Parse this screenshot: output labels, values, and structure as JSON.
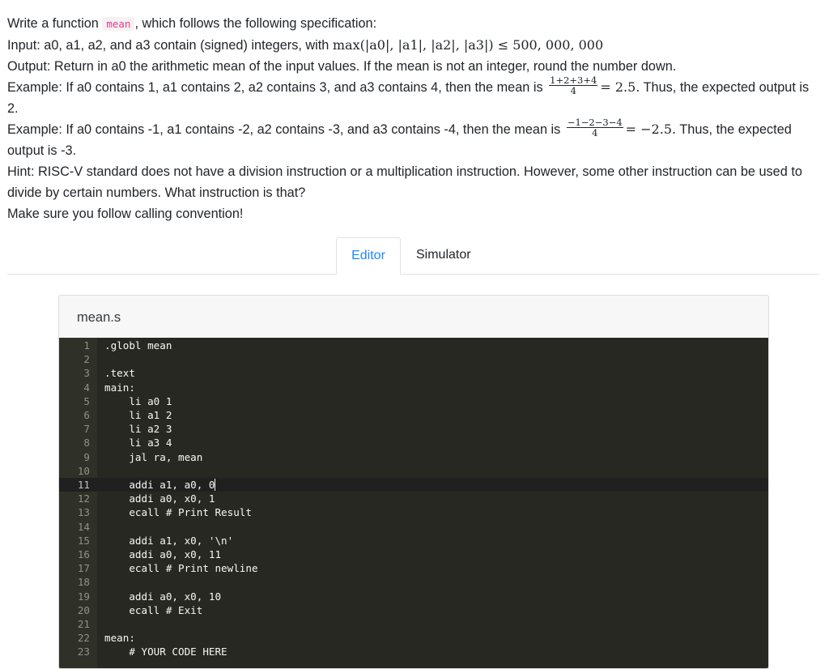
{
  "problem": {
    "line1_pre": "Write a function ",
    "func_name": "mean",
    "line1_post": ", which follows the following specification:",
    "input_pre": "Input: a0, a1, a2, and a3 contain (signed) integers, with ",
    "input_math": "max(|a0|, |a1|, |a2|, |a3|) ≤ 500, 000, 000",
    "output_text": "Output: Return in a0 the arithmetic mean of the input values. If the mean is not an integer, round the number down.",
    "ex1_pre": "Example: If a0 contains 1, a1 contains 2, a2 contains 3, and a3 contains 4, then the mean is ",
    "ex1_num": "1+2+3+4",
    "ex1_den": "4",
    "ex1_math": "= 2.5.",
    "ex1_post": " Thus, the expected output is 2.",
    "ex2_pre": "Example: If a0 contains -1, a1 contains -2, a2 contains -3, and a3 contains -4, then the mean is ",
    "ex2_num": "−1−2−3−4",
    "ex2_den": "4",
    "ex2_math": "= −2.5.",
    "ex2_post": " Thus, the expected output is -3.",
    "hint": "Hint: RISC-V standard does not have a division instruction or a multiplication instruction. However, some other instruction can be used to divide by certain numbers. What instruction is that?",
    "convention": "Make sure you follow calling convention!"
  },
  "tabs": [
    {
      "label": "Editor",
      "active": true
    },
    {
      "label": "Simulator",
      "active": false
    }
  ],
  "editor": {
    "filename": "mean.s",
    "active_line": 11,
    "lines": [
      ".globl mean",
      "",
      ".text",
      "main:",
      "    li a0 1",
      "    li a1 2",
      "    li a2 3",
      "    li a3 4",
      "    jal ra, mean",
      "",
      "    addi a1, a0, 0",
      "    addi a0, x0, 1",
      "    ecall # Print Result",
      "",
      "    addi a1, x0, '\\n'",
      "    addi a0, x0, 11",
      "    ecall # Print newline",
      "",
      "    addi a0, x0, 10",
      "    ecall # Exit",
      "",
      "mean:",
      "    # YOUR CODE HERE"
    ]
  },
  "colors": {
    "accent": "#1f87ff",
    "code_bg": "#272822",
    "code_fg": "#f8f8f2",
    "inline_code": "#e83e8c"
  }
}
